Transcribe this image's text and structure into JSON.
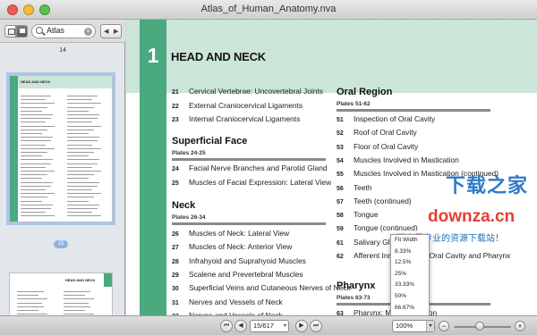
{
  "window": {
    "title": "Atlas_of_Human_Anatomy.nva"
  },
  "sidebar": {
    "search_value": "Atlas",
    "nav_prev": "◀",
    "nav_next": "▶",
    "page_above": "14",
    "selected_badge": "15"
  },
  "document": {
    "chapter_number": "1",
    "chapter_title": "HEAD AND NECK",
    "left_top_entries": [
      {
        "page": "21",
        "title": "Cervical Vertebrae: Uncovertebral Joints"
      },
      {
        "page": "22",
        "title": "External Craniocervical Ligaments"
      },
      {
        "page": "23",
        "title": "Internal Craniocervical Ligaments"
      }
    ],
    "superficial_face": {
      "heading": "Superficial Face",
      "plates": "Plates 24-25",
      "entries": [
        {
          "page": "24",
          "title": "Facial Nerve Branches and Parotid Gland"
        },
        {
          "page": "25",
          "title": "Muscles of Facial Expression: Lateral View"
        }
      ]
    },
    "neck": {
      "heading": "Neck",
      "plates": "Plates 26-34",
      "entries": [
        {
          "page": "26",
          "title": "Muscles of Neck: Lateral View"
        },
        {
          "page": "27",
          "title": "Muscles of Neck: Anterior View"
        },
        {
          "page": "28",
          "title": "Infrahyoid and Suprahyoid Muscles"
        },
        {
          "page": "29",
          "title": "Scalene and Prevertebral Muscles"
        },
        {
          "page": "30",
          "title": "Superficial Veins and Cutaneous Nerves of Neck"
        },
        {
          "page": "31",
          "title": "Nerves and Vessels of Neck"
        },
        {
          "page": "32",
          "title": "Nerves and Vessels of Neck"
        }
      ]
    },
    "oral_region": {
      "heading": "Oral Region",
      "plates": "Plates 51-62",
      "entries": [
        {
          "page": "51",
          "title": "Inspection of Oral Cavity"
        },
        {
          "page": "52",
          "title": "Roof of Oral Cavity"
        },
        {
          "page": "53",
          "title": "Floor of Oral Cavity"
        },
        {
          "page": "54",
          "title": "Muscles Involved in Mastication"
        },
        {
          "page": "55",
          "title": "Muscles Involved in Mastication (continued)"
        },
        {
          "page": "56",
          "title": "Teeth"
        },
        {
          "page": "57",
          "title": "Teeth (continued)"
        },
        {
          "page": "58",
          "title": "Tongue"
        },
        {
          "page": "59",
          "title": "Tongue (continued)"
        },
        {
          "page": "61",
          "title": "Salivary Glands"
        },
        {
          "page": "62",
          "title": "Afferent Innervation of Oral Cavity and Pharynx"
        }
      ]
    },
    "pharynx": {
      "heading": "Pharynx",
      "plates": "Plates 63-73",
      "entries": [
        {
          "page": "63",
          "title": "Pharynx: Median Section"
        }
      ]
    }
  },
  "zoom_menu": {
    "options": [
      "Fit Width",
      "8.33%",
      "12.5%",
      "25%",
      "33.33%",
      "50%",
      "66.67%"
    ]
  },
  "watermark": {
    "brand": "下载之家",
    "url": "downza.cn",
    "tagline": "国内最专业的资源下载站！"
  },
  "bottombar": {
    "first": "⏮",
    "prev": "◀",
    "page_field": "15/617",
    "next": "▶",
    "last": "⏭",
    "zoom_value": "100%",
    "zoom_out": "−",
    "zoom_in": "+",
    "zoom_level_fraction": 0.45
  },
  "colors": {
    "accent_green": "#4ba980",
    "band_green": "#cce5d9",
    "selection_blue": "#8fb3de"
  }
}
